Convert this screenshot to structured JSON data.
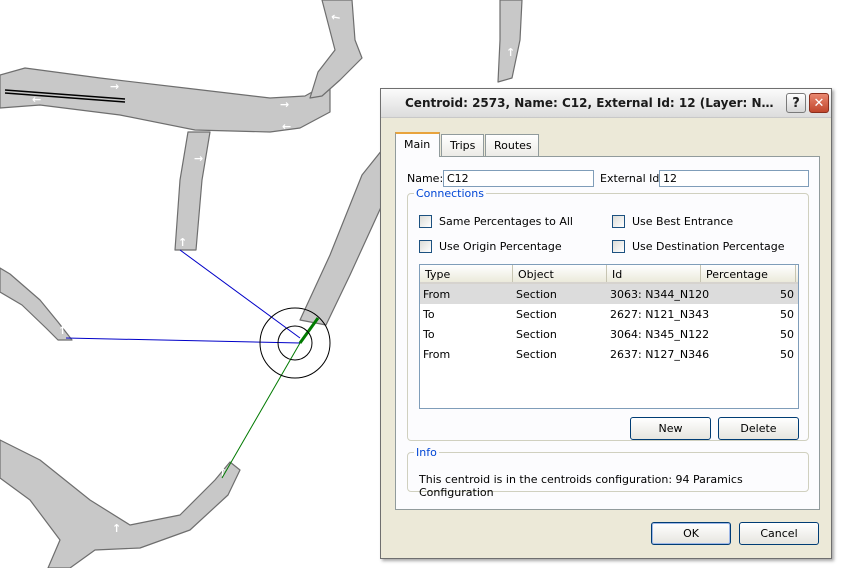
{
  "dialog": {
    "title": "Centroid: 2573, Name: C12, External Id: 12 (Layer: Netwo...",
    "help_label": "?",
    "close_label": "✕"
  },
  "tabs": [
    {
      "label": "Main",
      "active": true
    },
    {
      "label": "Trips",
      "active": false
    },
    {
      "label": "Routes",
      "active": false
    }
  ],
  "main": {
    "name_label": "Name:",
    "name_value": "C12",
    "external_id_label": "External Id:",
    "external_id_value": "12",
    "connections": {
      "legend": "Connections",
      "options": [
        {
          "label": "Same Percentages to All",
          "checked": false
        },
        {
          "label": "Use Best Entrance",
          "checked": false
        },
        {
          "label": "Use Origin Percentage",
          "checked": false
        },
        {
          "label": "Use Destination Percentage",
          "checked": false
        }
      ],
      "columns": [
        "Type",
        "Object",
        "Id",
        "Percentage"
      ],
      "rows": [
        {
          "type": "From",
          "object": "Section",
          "id": "3063: N344_N120",
          "percentage": "50",
          "selected": true
        },
        {
          "type": "To",
          "object": "Section",
          "id": "2627: N121_N343",
          "percentage": "50",
          "selected": false
        },
        {
          "type": "To",
          "object": "Section",
          "id": "3064: N345_N122",
          "percentage": "50",
          "selected": false
        },
        {
          "type": "From",
          "object": "Section",
          "id": "2637: N127_N346",
          "percentage": "50",
          "selected": false
        }
      ],
      "new_label": "New",
      "delete_label": "Delete"
    },
    "info": {
      "legend": "Info",
      "text": "This centroid is in the centroids configuration: 94 Paramics Configuration"
    }
  },
  "footer": {
    "ok_label": "OK",
    "cancel_label": "Cancel"
  },
  "colors": {
    "road": "#c8c8c8",
    "road_edge": "#6e6e6e",
    "origin_line": "#0000c8",
    "destination_line": "#007a00"
  },
  "icons": [
    "help-icon",
    "close-icon",
    "lane-arrow-icon"
  ]
}
